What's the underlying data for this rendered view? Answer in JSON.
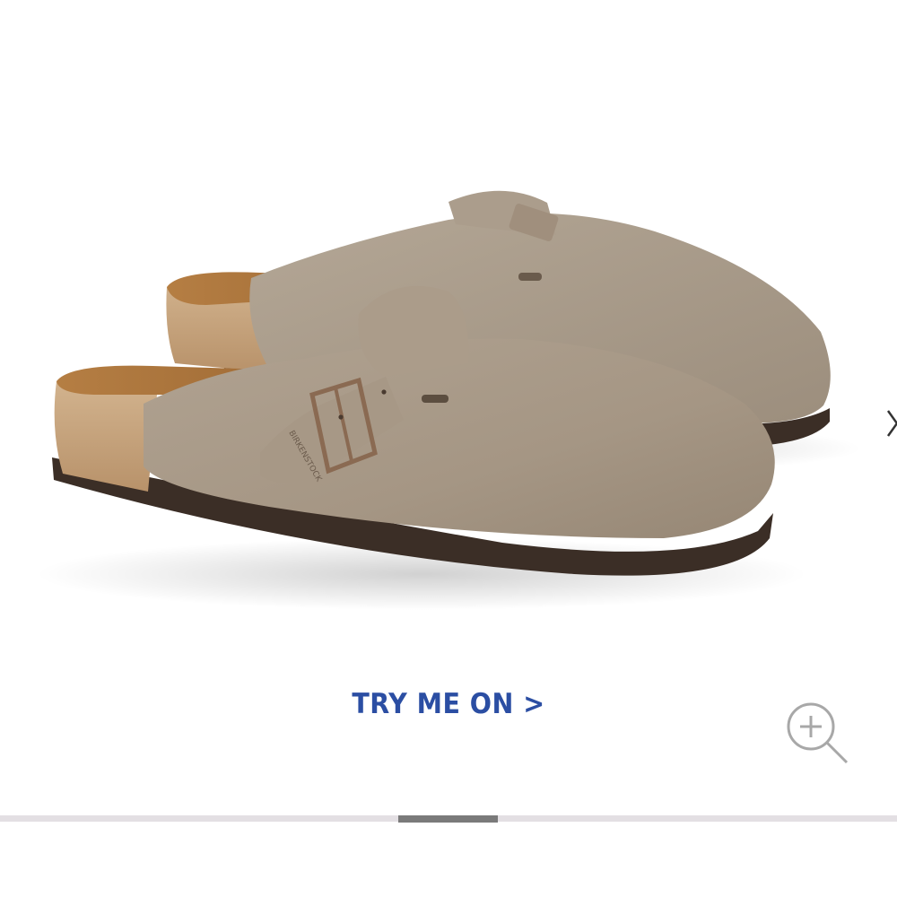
{
  "product": {
    "image_subject": "taupe suede clogs with buckle strap",
    "logo_text": "BIRKENSTOCK"
  },
  "cta": {
    "label": "TRY ME ON >"
  },
  "icons": {
    "next": "chevron-right-icon",
    "zoom": "zoom-in-icon"
  },
  "carousel": {
    "total_slides": 9,
    "current_slide": 5
  },
  "colors": {
    "cta_text": "#2b4ea3",
    "suede": "#a89a8a",
    "cork": "#c9a57e",
    "sole": "#3b2e26",
    "track": "#e3dfe3",
    "thumb": "#7a7a7a"
  }
}
